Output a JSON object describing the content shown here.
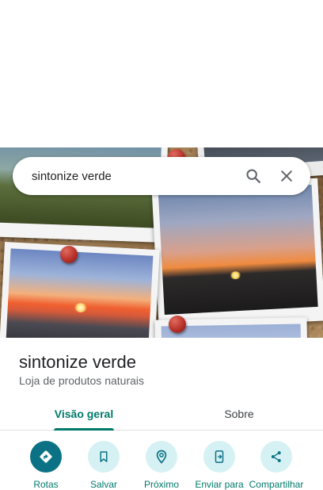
{
  "search": {
    "query": "sintonize verde"
  },
  "place": {
    "name": "sintonize verde",
    "category": "Loja de produtos naturais"
  },
  "tabs": [
    {
      "label": "Visão geral",
      "active": true
    },
    {
      "label": "Sobre",
      "active": false
    }
  ],
  "actions": [
    {
      "label": "Rotas",
      "icon": "directions-icon",
      "primary": true
    },
    {
      "label": "Salvar",
      "icon": "bookmark-icon"
    },
    {
      "label": "Próximo",
      "icon": "nearby-icon"
    },
    {
      "label": "Enviar para",
      "icon": "send-to-phone-icon"
    },
    {
      "label": "Compartilhar",
      "icon": "share-icon"
    }
  ],
  "colors": {
    "accent": "#00796b",
    "primary_button": "#0b7285",
    "button_tint": "#d6f1f3"
  }
}
